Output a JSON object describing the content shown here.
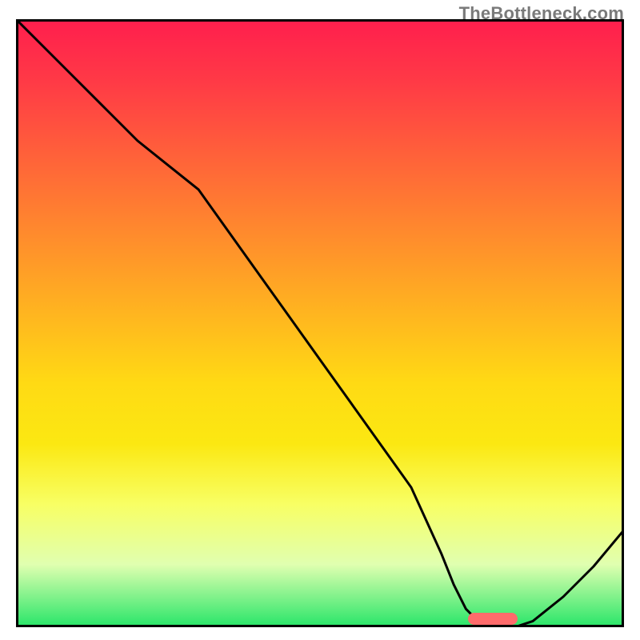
{
  "watermark": "TheBottleneck.com",
  "chart_data": {
    "type": "line",
    "title": "",
    "xlabel": "",
    "ylabel": "",
    "xlim": [
      0,
      100
    ],
    "ylim": [
      0,
      100
    ],
    "x": [
      0,
      5,
      10,
      15,
      20,
      25,
      30,
      35,
      40,
      45,
      50,
      55,
      60,
      65,
      70,
      72,
      74,
      76,
      78,
      80,
      82,
      85,
      90,
      95,
      100
    ],
    "y": [
      100,
      95,
      90,
      85,
      80,
      76,
      72,
      65,
      58,
      51,
      44,
      37,
      30,
      23,
      12,
      7,
      3,
      1,
      0,
      0,
      0,
      1,
      5,
      10,
      16
    ],
    "marker_range_x": [
      74,
      82
    ],
    "gradient_stops": [
      {
        "pos": 0.0,
        "color": "#ff1f4d"
      },
      {
        "pos": 0.3,
        "color": "#ff7a32"
      },
      {
        "pos": 0.6,
        "color": "#ffda14"
      },
      {
        "pos": 0.9,
        "color": "#e0ffb0"
      },
      {
        "pos": 1.0,
        "color": "#2ee66b"
      }
    ]
  }
}
